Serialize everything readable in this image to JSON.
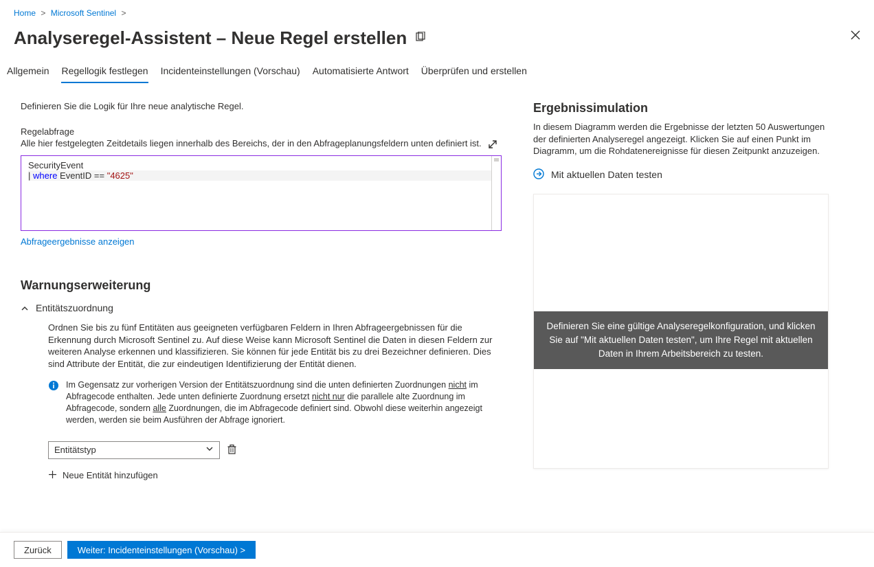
{
  "breadcrumb": {
    "home": "Home",
    "sentinel": "Microsoft Sentinel"
  },
  "page": {
    "title": "Analyseregel-Assistent – Neue Regel erstellen"
  },
  "tabs": {
    "general": "Allgemein",
    "logic": "Regellogik festlegen",
    "incidents": "Incidenteinstellungen (Vorschau)",
    "automated": "Automatisierte Antwort",
    "review": "Überprüfen und erstellen"
  },
  "left": {
    "intro": "Definieren Sie die Logik für Ihre neue analytische Regel.",
    "query_label": "Regelabfrage",
    "query_sub": "Alle hier festgelegten Zeitdetails liegen innerhalb des Bereichs, der in den Abfrageplanungsfeldern unten definiert ist.",
    "query_l1": "SecurityEvent",
    "query_pipe": "|",
    "query_where": "where",
    "query_cond": " EventID == ",
    "query_str": "\"4625\"",
    "view_results": "Abfrageergebnisse anzeigen",
    "section_title": "Warnungserweiterung",
    "accordion": "Entitätszuordnung",
    "para": "Ordnen Sie bis zu fünf Entitäten aus geeigneten verfügbaren Feldern in Ihren Abfrageergebnissen für die Erkennung durch Microsoft Sentinel zu. Auf diese Weise kann Microsoft Sentinel die Daten in diesen Feldern zur weiteren Analyse erkennen und klassifizieren. Sie können für jede Entität bis zu drei Bezeichner definieren. Dies sind Attribute der Entität, die zur eindeutigen Identifizierung der Entität dienen.",
    "info_p1": "Im Gegensatz zur vorherigen Version der Entitätszuordnung sind die unten definierten Zuordnungen ",
    "info_u1": "nicht",
    "info_p2": " im Abfragecode enthalten. Jede unten definierte Zuordnung ersetzt ",
    "info_u2": "nicht nur",
    "info_p3": " die parallele alte Zuordnung im Abfragecode, sondern ",
    "info_u3": "alle",
    "info_p4": " Zuordnungen, die im Abfragecode definiert sind. Obwohl diese weiterhin angezeigt werden, werden sie beim Ausführen der Abfrage ignoriert.",
    "entity_placeholder": "Entitätstyp",
    "add_entity": "Neue Entität hinzufügen"
  },
  "right": {
    "title": "Ergebnissimulation",
    "desc": "In diesem Diagramm werden die Ergebnisse der letzten 50 Auswertungen der definierten Analyseregel angezeigt. Klicken Sie auf einen Punkt im Diagramm, um die Rohdatenereignisse für diesen Zeitpunkt anzuzeigen.",
    "test": "Mit aktuellen Daten testen",
    "overlay": "Definieren Sie eine gültige Analyseregelkonfiguration, und klicken Sie auf \"Mit aktuellen Daten testen\", um Ihre Regel mit aktuellen Daten in Ihrem Arbeitsbereich zu testen."
  },
  "footer": {
    "back": "Zurück",
    "next": "Weiter: Incidenteinstellungen (Vorschau)  >"
  }
}
